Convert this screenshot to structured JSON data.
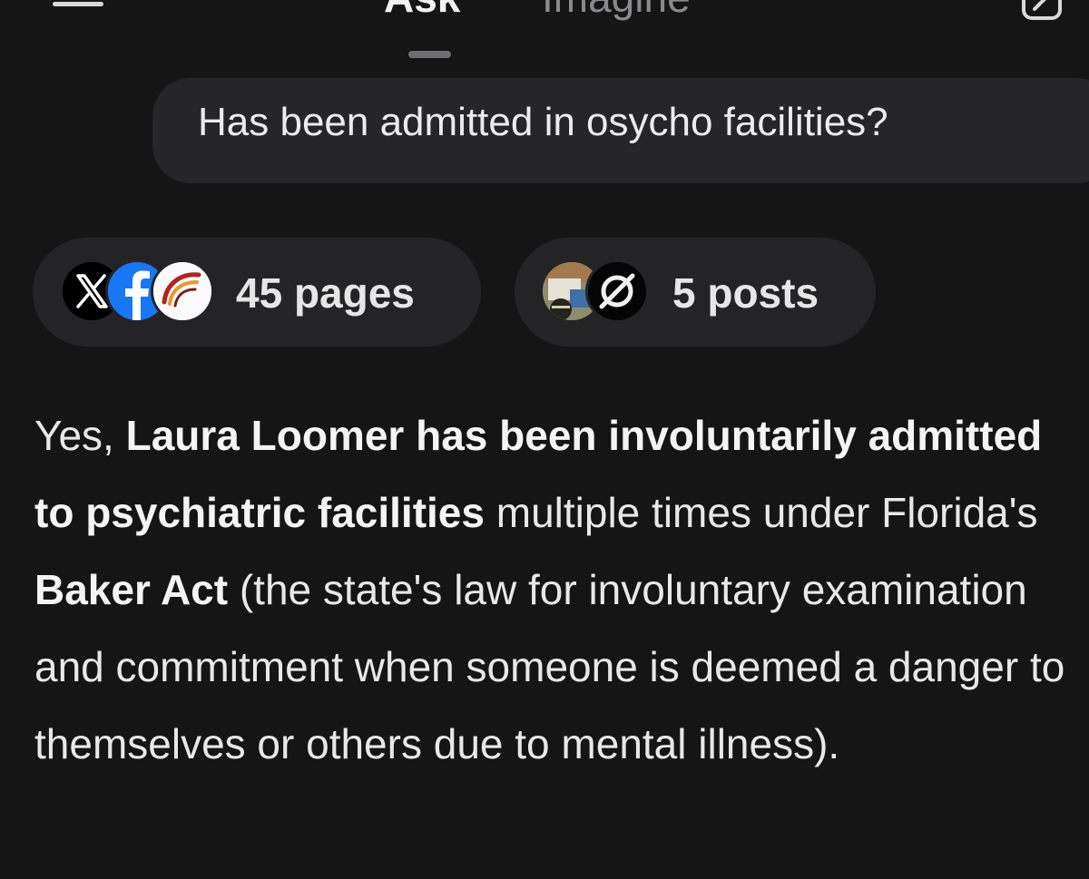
{
  "topbar": {
    "tabs": [
      {
        "label": "Ask",
        "active": true
      },
      {
        "label": "Imagine",
        "active": false
      }
    ],
    "icons": {
      "menu": "menu-icon",
      "edit": "edit-icon"
    }
  },
  "conversation": {
    "user_message": "Has been admitted in osycho facilities?",
    "sources": {
      "pages": {
        "label": "45 pages",
        "icons": [
          "x-logo-icon",
          "facebook-logo-icon",
          "news-logo-icon"
        ]
      },
      "posts": {
        "label": "5 posts",
        "icons": [
          "post-thumbnail-icon",
          "grok-logo-icon"
        ]
      }
    },
    "answer": {
      "t1": "Yes, ",
      "b1": "Laura Loomer has been involuntarily admitted to psychiatric facilities",
      "t2": " multiple times under Florida's ",
      "b2": "Baker Act",
      "t3": " (the state's law for involuntary examination and commitment when someone is deemed a danger to themselves or others due to mental illness)."
    }
  },
  "colors": {
    "background": "#151516",
    "bubble": "#262628",
    "pill": "#242426",
    "text": "#e8e8e8",
    "muted_tab": "#8a8a8c"
  }
}
